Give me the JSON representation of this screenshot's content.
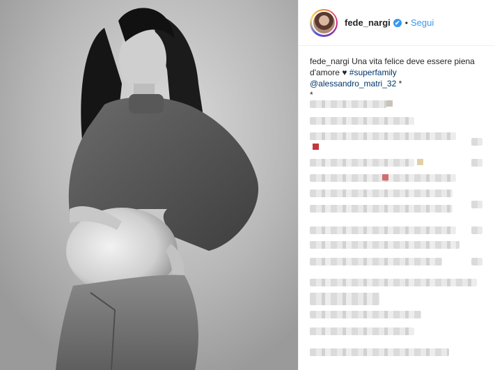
{
  "header": {
    "username": "fede_nargi",
    "verified_glyph": "✔",
    "separator": "•",
    "follow_label": "Segui"
  },
  "caption": {
    "username": "fede_nargi",
    "text_1": "Una vita felice deve essere piena d'amore ♥",
    "hashtag": "#superfamily",
    "mention": "@alessandro_matri_32",
    "trail_1": "*",
    "trail_2": "*"
  },
  "colors": {
    "accent": "#3897f0",
    "link": "#003569",
    "text": "#262626",
    "border": "#efefef"
  },
  "icons": {
    "verified": "verified-badge-icon"
  }
}
